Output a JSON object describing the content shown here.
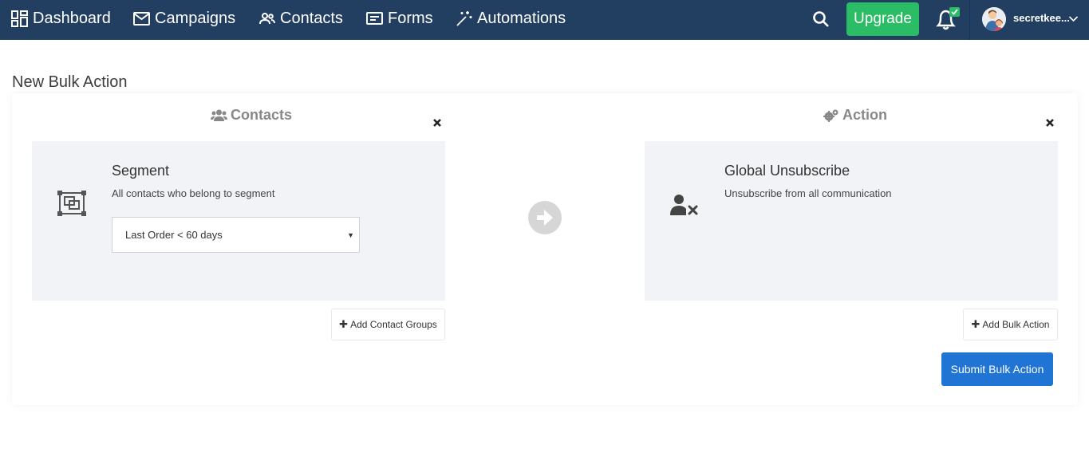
{
  "nav": {
    "dashboard": "Dashboard",
    "campaigns": "Campaigns",
    "contacts": "Contacts",
    "forms": "Forms",
    "automations": "Automations",
    "upgrade": "Upgrade",
    "user_name": "secretkee..."
  },
  "page": {
    "title": "New Bulk Action"
  },
  "contacts_col": {
    "title": "Contacts",
    "heading": "Segment",
    "description": "All contacts who belong to segment",
    "selected_segment": "Last Order < 60 days",
    "add_button": "Add Contact Groups"
  },
  "action_col": {
    "title": "Action",
    "heading": "Global Unsubscribe",
    "description": "Unsubscribe from all communication",
    "add_button": "Add Bulk Action"
  },
  "submit_label": "Submit Bulk Action",
  "colors": {
    "nav_bg": "#223f61",
    "upgrade": "#2bbd65",
    "submit": "#1f74d4",
    "panel_bg": "#f2f3f7",
    "notification_badge": "#2bbd65"
  },
  "icons": {
    "dashboard": "dashboard-grid-icon",
    "campaigns": "envelope-icon",
    "contacts": "users-icon",
    "forms": "form-icon",
    "automations": "magic-wand-icon",
    "search": "search-icon",
    "bell": "bell-icon",
    "segment": "segment-icon",
    "unsubscribe": "user-x-icon",
    "arrow": "arrow-right-circle-icon"
  }
}
